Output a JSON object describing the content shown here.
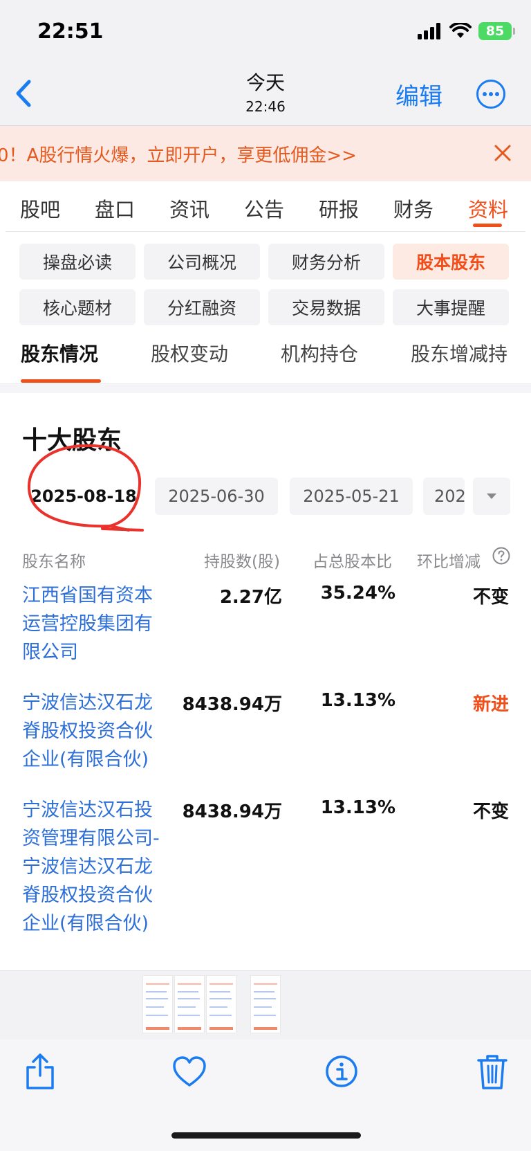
{
  "status_bar": {
    "time": "22:51",
    "battery": "85"
  },
  "nav": {
    "title": "今天",
    "subtitle": "22:46",
    "edit_label": "编辑"
  },
  "banner": {
    "text": "0！A股行情火爆，立即开户，享更低佣金>>"
  },
  "main_tabs": [
    {
      "label": "股吧"
    },
    {
      "label": "盘口"
    },
    {
      "label": "资讯"
    },
    {
      "label": "公告"
    },
    {
      "label": "研报"
    },
    {
      "label": "财务"
    },
    {
      "label": "资料"
    }
  ],
  "chips": [
    {
      "label": "操盘必读"
    },
    {
      "label": "公司概况"
    },
    {
      "label": "财务分析"
    },
    {
      "label": "股本股东"
    },
    {
      "label": "核心题材"
    },
    {
      "label": "分红融资"
    },
    {
      "label": "交易数据"
    },
    {
      "label": "大事提醒"
    }
  ],
  "sub_tabs": [
    {
      "label": "股东情况"
    },
    {
      "label": "股权变动"
    },
    {
      "label": "机构持仓"
    },
    {
      "label": "股东增减持"
    }
  ],
  "section": {
    "title": "十大股东"
  },
  "dates": [
    {
      "label": "2025-08-18"
    },
    {
      "label": "2025-06-30"
    },
    {
      "label": "2025-05-21"
    },
    {
      "label": "202"
    }
  ],
  "table": {
    "headers": {
      "name": "股东名称",
      "shares": "持股数(股)",
      "ratio": "占总股本比",
      "change": "环比增减"
    },
    "rows": [
      {
        "name": "江西省国有资本运营控股集团有限公司",
        "shares": "2.27亿",
        "ratio": "35.24%",
        "change": "不变"
      },
      {
        "name": "宁波信达汉石龙脊股权投资合伙企业(有限合伙)",
        "shares": "8438.94万",
        "ratio": "13.13%",
        "change": "新进"
      },
      {
        "name": "宁波信达汉石投资管理有限公司-宁波信达汉石龙脊股权投资合伙企业(有限合伙)",
        "shares": "8438.94万",
        "ratio": "13.13%",
        "change": "不变"
      }
    ]
  },
  "colors": {
    "accent": "#f04e1a",
    "link": "#2d6fd6",
    "ios_blue": "#1a7cf0"
  }
}
